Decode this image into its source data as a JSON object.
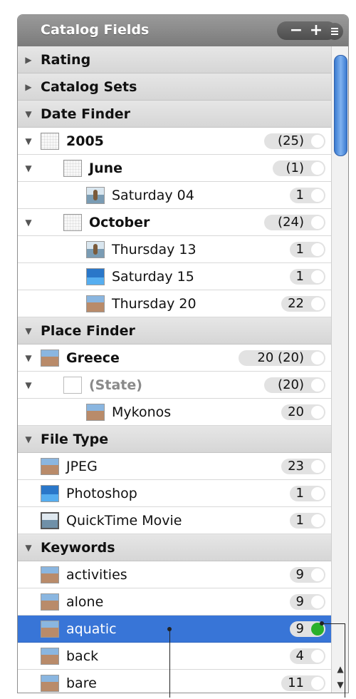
{
  "panel": {
    "title": "Catalog Fields",
    "minus_label": "−",
    "plus_label": "+"
  },
  "rows": [
    {
      "type": "header",
      "label": "Rating",
      "expanded": false
    },
    {
      "type": "header",
      "label": "Catalog Sets",
      "expanded": false
    },
    {
      "type": "header",
      "label": "Date Finder",
      "expanded": true
    },
    {
      "type": "item",
      "level": 0,
      "expanded": true,
      "icon": "calendar-icon",
      "label": "2005",
      "bold": true,
      "count": "(25)"
    },
    {
      "type": "item",
      "level": 1,
      "expanded": true,
      "icon": "calendar-icon",
      "label": "June",
      "bold": true,
      "count": "(1)"
    },
    {
      "type": "item",
      "level": 2,
      "icon": "photo-person-icon",
      "label": "Saturday 04",
      "count": "1"
    },
    {
      "type": "item",
      "level": 1,
      "expanded": true,
      "icon": "calendar-icon",
      "label": "October",
      "bold": true,
      "count": "(24)"
    },
    {
      "type": "item",
      "level": 2,
      "icon": "photo-person-icon",
      "label": "Thursday 13",
      "count": "1"
    },
    {
      "type": "item",
      "level": 2,
      "icon": "photo-sea-icon",
      "label": "Saturday 15",
      "count": "1"
    },
    {
      "type": "item",
      "level": 2,
      "icon": "photo-beach-icon",
      "label": "Thursday 20",
      "count": "22"
    },
    {
      "type": "header",
      "label": "Place Finder",
      "expanded": true
    },
    {
      "type": "item",
      "level": 0,
      "expanded": true,
      "icon": "photo-beach-icon",
      "label": "Greece",
      "bold": true,
      "count": "20 (20)"
    },
    {
      "type": "item",
      "level": 1,
      "expanded": true,
      "icon": "place-icon",
      "label": "(State)",
      "gray": true,
      "count": "(20)"
    },
    {
      "type": "item",
      "level": 2,
      "icon": "photo-beach-icon",
      "label": "Mykonos",
      "count": "20"
    },
    {
      "type": "header",
      "label": "File Type",
      "expanded": true
    },
    {
      "type": "item",
      "level": 0,
      "icon": "photo-beach-icon",
      "label": "JPEG",
      "count": "23"
    },
    {
      "type": "item",
      "level": 0,
      "icon": "photo-sea-icon",
      "label": "Photoshop",
      "count": "1"
    },
    {
      "type": "item",
      "level": 0,
      "icon": "movie-icon",
      "label": "QuickTime Movie",
      "count": "1"
    },
    {
      "type": "header",
      "label": "Keywords",
      "expanded": true
    },
    {
      "type": "item",
      "level": 0,
      "icon": "photo-beach-icon",
      "label": "activities",
      "count": "9"
    },
    {
      "type": "item",
      "level": 0,
      "icon": "photo-beach-icon",
      "label": "alone",
      "count": "9"
    },
    {
      "type": "item",
      "level": 0,
      "icon": "photo-beach-icon",
      "label": "aquatic",
      "count": "9",
      "selected": true,
      "enabled": true
    },
    {
      "type": "item",
      "level": 0,
      "icon": "photo-beach-icon",
      "label": "back",
      "count": "4"
    },
    {
      "type": "item",
      "level": 0,
      "icon": "photo-beach-icon",
      "label": "bare",
      "count": "11"
    }
  ],
  "colors": {
    "selection": "#3875d7",
    "enabled_dot": "#2ab02a",
    "scroll_thumb": "#3a7ad0"
  }
}
